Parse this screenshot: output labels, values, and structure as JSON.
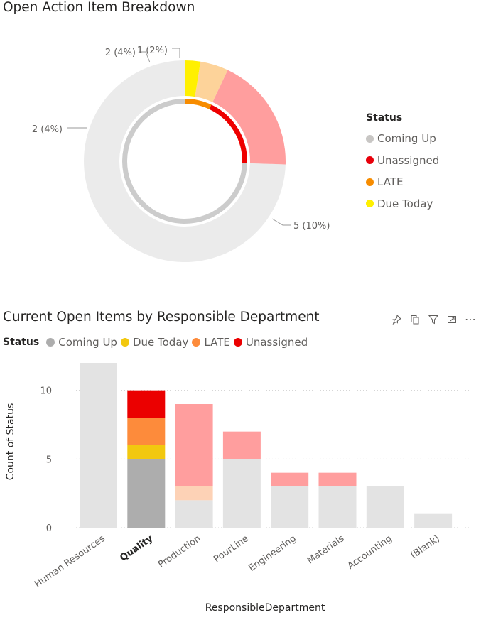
{
  "page": {
    "donut_title": "Open Action Item Breakdown",
    "bar_title": "Current Open Items by Responsible Department"
  },
  "donut_legend": {
    "title": "Status",
    "items": [
      {
        "label": "Coming Up",
        "color": "#c8c6c4"
      },
      {
        "label": "Unassigned",
        "color": "#e8000b"
      },
      {
        "label": "LATE",
        "color": "#f78c00"
      },
      {
        "label": "Due Today",
        "color": "#fff000"
      }
    ]
  },
  "bar_legend": {
    "title": "Status",
    "items": [
      {
        "label": "Coming Up",
        "color": "#adadad"
      },
      {
        "label": "Due Today",
        "color": "#f2c80f"
      },
      {
        "label": "LATE",
        "color": "#fd8b3b"
      },
      {
        "label": "Unassigned",
        "color": "#eb0000"
      }
    ]
  },
  "toolbar": {
    "icons": [
      "pin-icon",
      "copy-icon",
      "filter-icon",
      "focus-mode-icon",
      "more-options-icon"
    ],
    "more_label": "⋯"
  },
  "chart_data": [
    {
      "type": "pie",
      "variant": "donut",
      "title": "Open Action Item Breakdown",
      "legend_title": "Status",
      "legend_position": "right",
      "slices": [
        {
          "label": "Coming Up",
          "value": 5,
          "percent": "10%",
          "data_label": "5 (10%)",
          "color": "#ebebeb"
        },
        {
          "label": "Unassigned",
          "value": 2,
          "percent": "4%",
          "data_label": "2 (4%)",
          "color": "#ff9e9e"
        },
        {
          "label": "LATE",
          "value": 2,
          "percent": "4%",
          "data_label": "2 (4%)",
          "color": "#fdd39a"
        },
        {
          "label": "Due Today",
          "value": 1,
          "percent": "2%",
          "data_label": "1 (2%)",
          "color": "#fff000"
        }
      ],
      "display_fractions": [
        0.745,
        0.185,
        0.045,
        0.025
      ],
      "inner_ring": [
        {
          "label": "Coming Up",
          "fraction": 0.745,
          "color": "#cccccc"
        },
        {
          "label": "Unassigned",
          "fraction": 0.185,
          "color": "#ee0000"
        },
        {
          "label": "LATE",
          "fraction": 0.07,
          "color": "#f78c00"
        }
      ]
    },
    {
      "type": "bar",
      "stacked": true,
      "title": "Current Open Items by Responsible Department",
      "xlabel": "ResponsibleDepartment",
      "ylabel": "Count of Status",
      "ylim": [
        0,
        12
      ],
      "yticks": [
        0,
        5,
        10
      ],
      "grid": true,
      "legend_position": "top-left",
      "categories": [
        "Human Resources",
        "Quality",
        "Production",
        "PourLine",
        "Engineering",
        "Materials",
        "Accounting",
        "(Blank)"
      ],
      "highlighted_category": "Quality",
      "series": [
        {
          "name": "Coming Up",
          "values": [
            12,
            5,
            2,
            5,
            3,
            3,
            3,
            1
          ],
          "color": "#adadad",
          "faded_color": "#e3e3e3"
        },
        {
          "name": "Due Today",
          "values": [
            0,
            1,
            0,
            0,
            0,
            0,
            0,
            0
          ],
          "color": "#f2c80f",
          "faded_color": "#f9e58d"
        },
        {
          "name": "LATE",
          "values": [
            0,
            2,
            1,
            0,
            0,
            0,
            0,
            0
          ],
          "color": "#fd8b3b",
          "faded_color": "#fdd2b6"
        },
        {
          "name": "Unassigned",
          "values": [
            0,
            2,
            6,
            2,
            1,
            1,
            0,
            0
          ],
          "color": "#eb0000",
          "faded_color": "#ff9e9e"
        }
      ]
    }
  ]
}
